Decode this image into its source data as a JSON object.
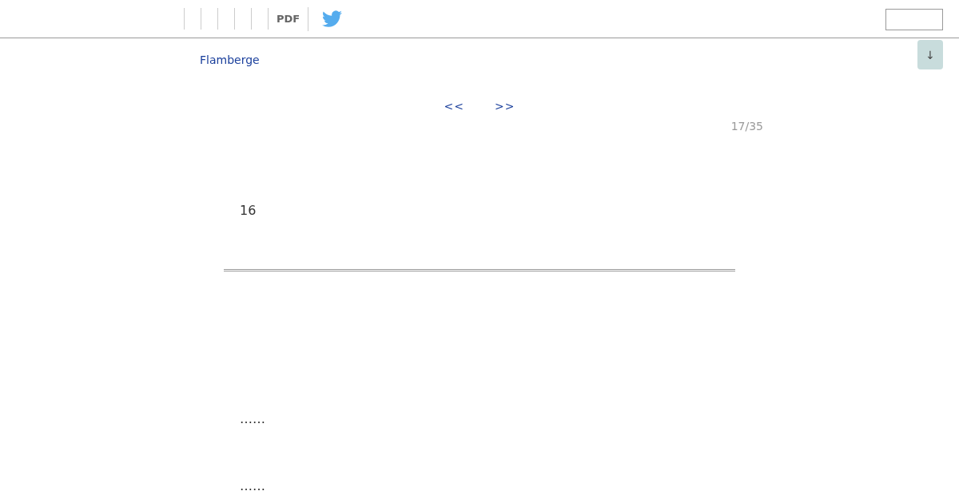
{
  "header": {
    "pdf_link": "PDF"
  },
  "back_to_top": "↓",
  "book_title": "Flamberge",
  "pager": {
    "prev": "<<",
    "next": ">>",
    "page_count": "17/35"
  },
  "chapter": {
    "heading": "16",
    "paragraphs": [
      "……",
      "……"
    ]
  }
}
